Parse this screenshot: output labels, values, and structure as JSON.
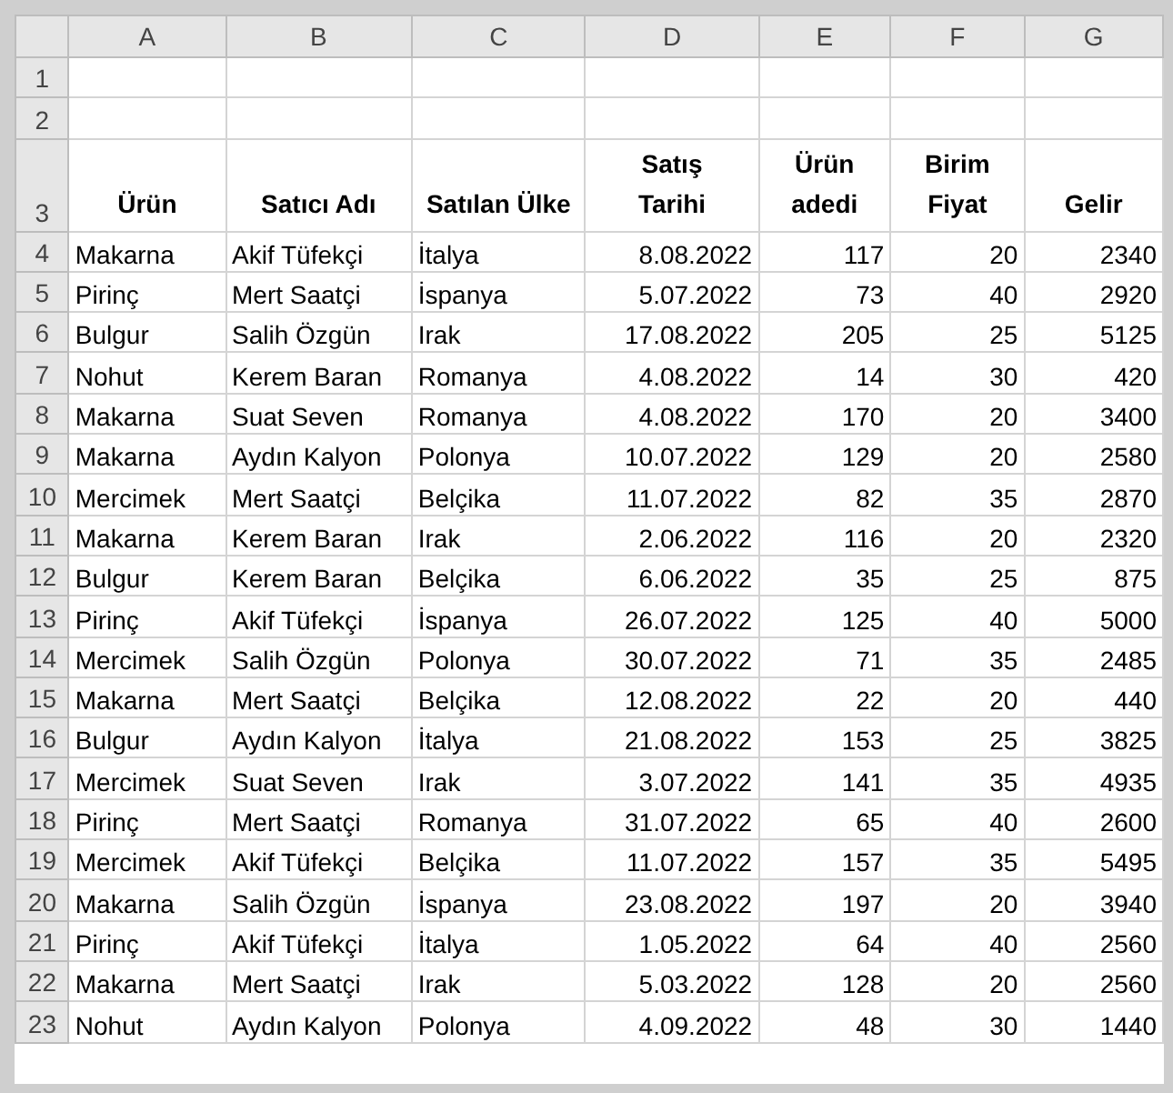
{
  "columns": [
    {
      "letter": "A",
      "kind": "text"
    },
    {
      "letter": "B",
      "kind": "text"
    },
    {
      "letter": "C",
      "kind": "text"
    },
    {
      "letter": "D",
      "kind": "number"
    },
    {
      "letter": "E",
      "kind": "number"
    },
    {
      "letter": "F",
      "kind": "number"
    },
    {
      "letter": "G",
      "kind": "number"
    }
  ],
  "rows": [
    {
      "number": "1",
      "kind": "empty"
    },
    {
      "number": "2",
      "kind": "empty"
    },
    {
      "number": "3",
      "kind": "header",
      "cells": [
        [
          "Ürün"
        ],
        [
          "Satıcı Adı"
        ],
        [
          "Satılan Ülke"
        ],
        [
          "Satış",
          "Tarihi"
        ],
        [
          "Ürün",
          "adedi"
        ],
        [
          "Birim",
          "Fiyat"
        ],
        [
          "Gelir"
        ]
      ]
    },
    {
      "number": "4",
      "kind": "data",
      "cells": [
        "Makarna",
        "Akif Tüfekçi",
        "İtalya",
        "8.08.2022",
        "117",
        "20",
        "2340"
      ]
    },
    {
      "number": "5",
      "kind": "data",
      "cells": [
        "Pirinç",
        "Mert Saatçi",
        "İspanya",
        "5.07.2022",
        "73",
        "40",
        "2920"
      ]
    },
    {
      "number": "6",
      "kind": "data",
      "cells": [
        "Bulgur",
        "Salih Özgün",
        "Irak",
        "17.08.2022",
        "205",
        "25",
        "5125"
      ]
    },
    {
      "number": "7",
      "kind": "data",
      "cells": [
        "Nohut",
        "Kerem Baran",
        "Romanya",
        "4.08.2022",
        "14",
        "30",
        "420"
      ]
    },
    {
      "number": "8",
      "kind": "data",
      "cells": [
        "Makarna",
        "Suat Seven",
        "Romanya",
        "4.08.2022",
        "170",
        "20",
        "3400"
      ]
    },
    {
      "number": "9",
      "kind": "data",
      "cells": [
        "Makarna",
        "Aydın Kalyon",
        "Polonya",
        "10.07.2022",
        "129",
        "20",
        "2580"
      ]
    },
    {
      "number": "10",
      "kind": "data",
      "cells": [
        "Mercimek",
        "Mert Saatçi",
        "Belçika",
        "11.07.2022",
        "82",
        "35",
        "2870"
      ]
    },
    {
      "number": "11",
      "kind": "data",
      "cells": [
        "Makarna",
        "Kerem Baran",
        "Irak",
        "2.06.2022",
        "116",
        "20",
        "2320"
      ]
    },
    {
      "number": "12",
      "kind": "data",
      "cells": [
        "Bulgur",
        "Kerem Baran",
        "Belçika",
        "6.06.2022",
        "35",
        "25",
        "875"
      ]
    },
    {
      "number": "13",
      "kind": "data",
      "cells": [
        "Pirinç",
        "Akif Tüfekçi",
        "İspanya",
        "26.07.2022",
        "125",
        "40",
        "5000"
      ]
    },
    {
      "number": "14",
      "kind": "data",
      "cells": [
        "Mercimek",
        "Salih Özgün",
        "Polonya",
        "30.07.2022",
        "71",
        "35",
        "2485"
      ]
    },
    {
      "number": "15",
      "kind": "data",
      "cells": [
        "Makarna",
        "Mert Saatçi",
        "Belçika",
        "12.08.2022",
        "22",
        "20",
        "440"
      ]
    },
    {
      "number": "16",
      "kind": "data",
      "cells": [
        "Bulgur",
        "Aydın Kalyon",
        "İtalya",
        "21.08.2022",
        "153",
        "25",
        "3825"
      ]
    },
    {
      "number": "17",
      "kind": "data",
      "cells": [
        "Mercimek",
        "Suat Seven",
        "Irak",
        "3.07.2022",
        "141",
        "35",
        "4935"
      ]
    },
    {
      "number": "18",
      "kind": "data",
      "cells": [
        "Pirinç",
        "Mert Saatçi",
        "Romanya",
        "31.07.2022",
        "65",
        "40",
        "2600"
      ]
    },
    {
      "number": "19",
      "kind": "data",
      "cells": [
        "Mercimek",
        "Akif Tüfekçi",
        "Belçika",
        "11.07.2022",
        "157",
        "35",
        "5495"
      ]
    },
    {
      "number": "20",
      "kind": "data",
      "cells": [
        "Makarna",
        "Salih Özgün",
        "İspanya",
        "23.08.2022",
        "197",
        "20",
        "3940"
      ]
    },
    {
      "number": "21",
      "kind": "data",
      "cells": [
        "Pirinç",
        "Akif Tüfekçi",
        "İtalya",
        "1.05.2022",
        "64",
        "40",
        "2560"
      ]
    },
    {
      "number": "22",
      "kind": "data",
      "cells": [
        "Makarna",
        "Mert Saatçi",
        "Irak",
        "5.03.2022",
        "128",
        "20",
        "2560"
      ]
    },
    {
      "number": "23",
      "kind": "data",
      "cells": [
        "Nohut",
        "Aydın Kalyon",
        "Polonya",
        "4.09.2022",
        "48",
        "30",
        "1440"
      ]
    }
  ]
}
